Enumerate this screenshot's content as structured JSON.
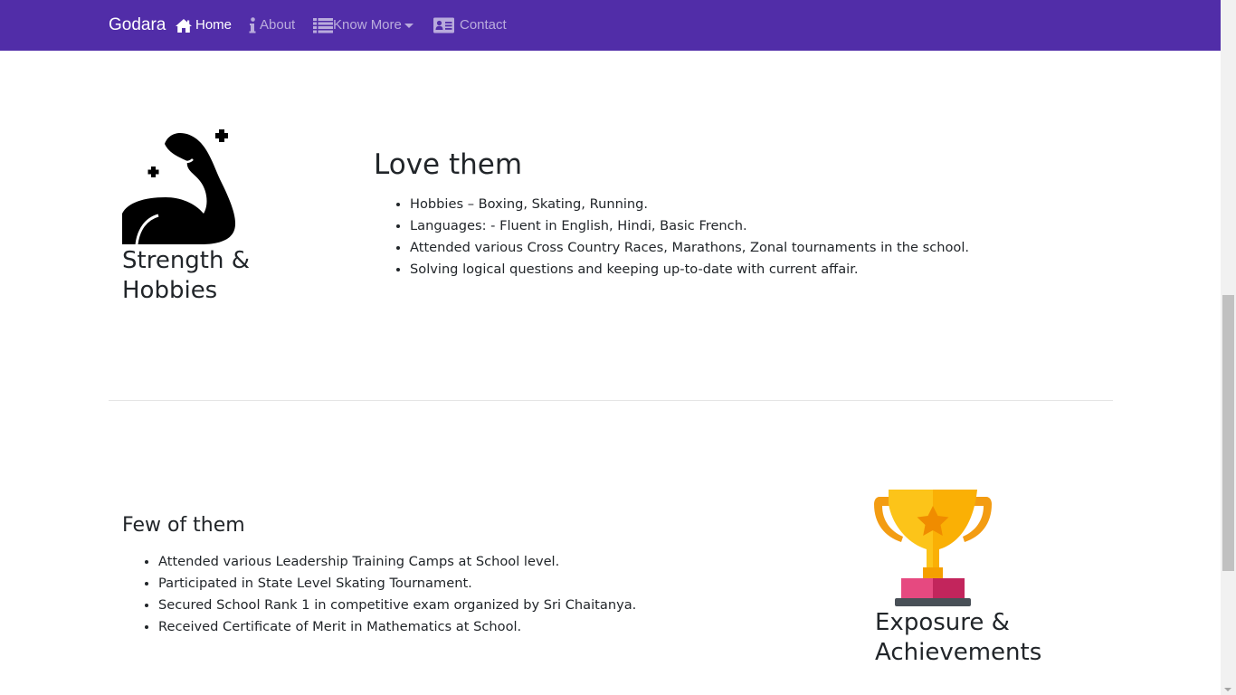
{
  "navbar": {
    "brand": "Godara",
    "items": [
      {
        "label": "Home",
        "icon": "home-icon",
        "active": true
      },
      {
        "label": "About",
        "icon": "info-icon",
        "active": false
      },
      {
        "label": "Know More",
        "icon": "list-icon",
        "active": false,
        "dropdown": true
      },
      {
        "label": "Contact",
        "icon": "address-card-icon",
        "active": false
      }
    ],
    "colors": {
      "background": "#512da8",
      "active_text": "#ffffff",
      "inactive_text": "rgba(255,255,255,0.6)"
    }
  },
  "strength_section": {
    "icon": "flexed-arm-icon",
    "title": "Strength & Hobbies",
    "heading": "Love them",
    "items": [
      "Hobbies – Boxing, Skating, Running.",
      "Languages: - Fluent in English, Hindi, Basic French.",
      "Attended various Cross Country Races, Marathons, Zonal tournaments in the school.",
      "Solving logical questions and keeping up-to-date with current affair."
    ]
  },
  "exposure_section": {
    "icon": "trophy-icon",
    "title": "Exposure & Achievements",
    "heading": "Few of them",
    "items": [
      "Attended various Leadership Training Camps at School level.",
      "Participated in State Level Skating Tournament.",
      "Secured School Rank 1 in competitive exam organized by Sri Chaitanya.",
      "Received Certificate of Merit in Mathematics at School."
    ]
  }
}
